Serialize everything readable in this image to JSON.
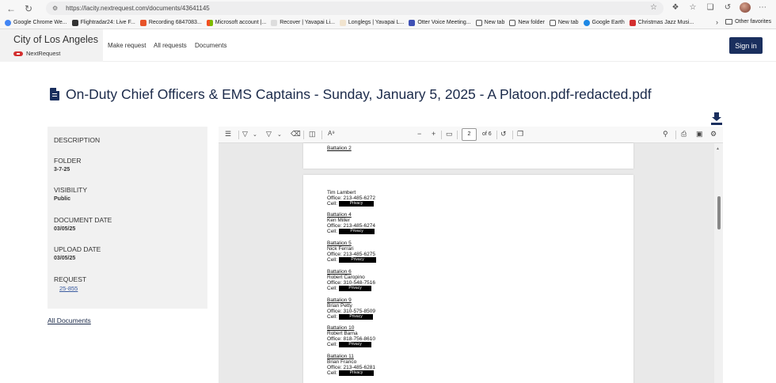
{
  "browser": {
    "url": "https://lacity.nextrequest.com/documents/43641145",
    "bookmarks": [
      {
        "label": "Google Chrome We...",
        "color": "#4285f4"
      },
      {
        "label": "Flightradar24: Live F...",
        "color": "#333333"
      },
      {
        "label": "Recording 6847083...",
        "color": "#e8542a"
      },
      {
        "label": "Microsoft account |...",
        "color": "#7cb342"
      },
      {
        "label": "Recover | Yavapai Li...",
        "color": "#bdbdbd"
      },
      {
        "label": "Longlegs | Yavapai L...",
        "color": "#e0c8a0"
      },
      {
        "label": "Otter Voice Meeting...",
        "color": "#3f51b5"
      },
      {
        "label": "New tab",
        "color": "#555555"
      },
      {
        "label": "New folder",
        "color": "#ffffff"
      },
      {
        "label": "New tab",
        "color": "#555555"
      },
      {
        "label": "Google Earth",
        "color": "#1e88e5"
      },
      {
        "label": "Christmas Jazz Musi...",
        "color": "#d32f2f"
      }
    ],
    "other_favorites": "Other favorites"
  },
  "header": {
    "city": "City of Los Angeles",
    "brand": "NextRequest",
    "nav": [
      "Make request",
      "All requests",
      "Documents"
    ],
    "signin": "Sign in"
  },
  "document": {
    "title": "On-Duty Chief Officers & EMS Captains - Sunday, January 5, 2025 - A Platoon.pdf-redacted.pdf"
  },
  "sidebar": {
    "description_label": "DESCRIPTION",
    "folder_label": "FOLDER",
    "folder_value": "3-7-25",
    "visibility_label": "VISIBILITY",
    "visibility_value": "Public",
    "document_date_label": "DOCUMENT DATE",
    "document_date_value": "03/05/25",
    "upload_date_label": "UPLOAD DATE",
    "upload_date_value": "03/05/25",
    "request_label": "REQUEST",
    "request_value": "25-855",
    "all_documents": "All Documents"
  },
  "viewer": {
    "page_current": "2",
    "page_total": "of 6",
    "page1_tail": "Battalion 2",
    "entries": [
      {
        "battalion": "",
        "name": "Tim Lambert",
        "office": "Office: 213-485-6272",
        "cell": "Cell:",
        "redaction": "Privacy"
      },
      {
        "battalion": "Battalion 4",
        "name": "Ken Miller",
        "office": "Office: 213-485-6274",
        "cell": "Cell:",
        "redaction": "Privacy"
      },
      {
        "battalion": "Battalion 5",
        "name": "Nick Ferrari",
        "office": "Office: 213-485-6275",
        "cell": "Cell:",
        "redaction": "Privacy"
      },
      {
        "battalion": "Battalion 6",
        "name": "Robert Caropino",
        "office": "Office: 310-548-7516",
        "cell": "Cell:",
        "redaction": "Privacy"
      },
      {
        "battalion": "Battalion 9",
        "name": "Brian Petty",
        "office": "Office: 310-575-8509",
        "cell": "Cell:",
        "redaction": "Privacy"
      },
      {
        "battalion": "Battalion 10",
        "name": "Robert Barna",
        "office": "Office: 818-756-8610",
        "cell": "Cell:",
        "redaction": "Privacy"
      },
      {
        "battalion": "Battalion 11",
        "name": "Brian Franco",
        "office": "Office: 213-485-6281",
        "cell": "Cell:",
        "redaction": "Privacy"
      }
    ]
  }
}
